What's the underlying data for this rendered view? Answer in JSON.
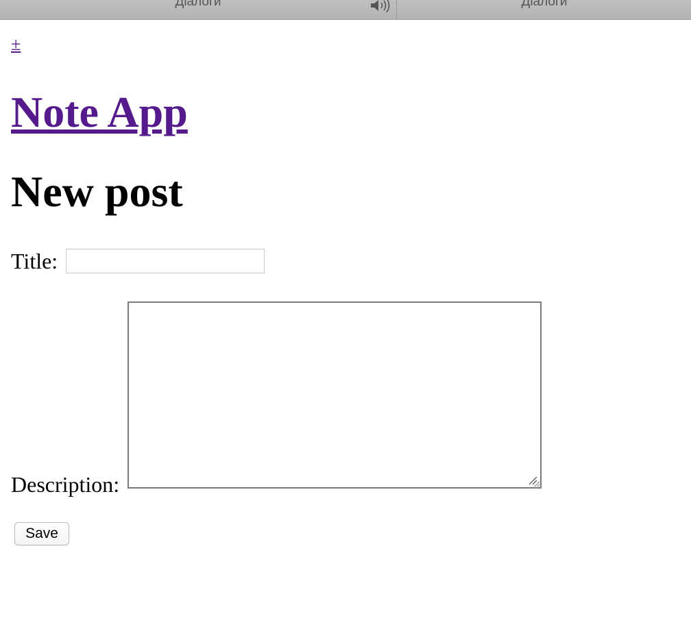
{
  "tabs": [
    {
      "label": "Діалоги",
      "audio_icon": "speaker-icon"
    },
    {
      "label": "Діалоги"
    }
  ],
  "nav": {
    "plus_link": "±"
  },
  "app": {
    "title": "Note App"
  },
  "page": {
    "title": "New post"
  },
  "form": {
    "title_label": "Title:",
    "title_value": "",
    "description_label": "Description:",
    "description_value": "",
    "save_label": "Save"
  },
  "colors": {
    "link": "#551a8b",
    "tabbar": "#b7b7b7"
  }
}
